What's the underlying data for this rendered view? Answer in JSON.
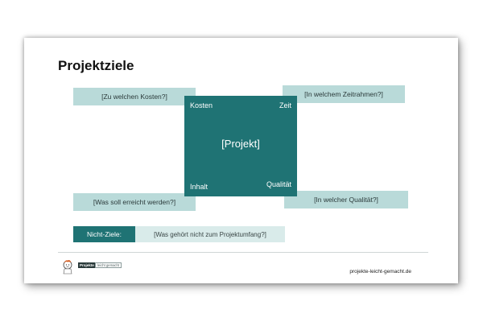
{
  "slide": {
    "title": "Projektziele",
    "questions": {
      "kosten": "[Zu welchen Kosten?]",
      "zeit": "[In welchem Zeitrahmen?]",
      "inhalt": "[Was soll erreicht werden?]",
      "qualitaet": "[In welcher Qualität?]"
    },
    "square": {
      "center": "[Projekt]",
      "top_left": "Kosten",
      "top_right": "Zeit",
      "bottom_left": "Inhalt",
      "bottom_right": "Qualität"
    },
    "nicht_ziele": {
      "label": "Nicht-Ziele:",
      "text": "[Was gehört nicht zum Projektumfang?]"
    },
    "footer": {
      "logo_word1": "Projekte",
      "logo_word2": "leicht gemacht",
      "url": "projekte-leicht-gemacht.de"
    },
    "colors": {
      "teal_dark": "#1f7374",
      "teal_light": "#b9dad9",
      "teal_pale": "#d9ebea"
    }
  }
}
